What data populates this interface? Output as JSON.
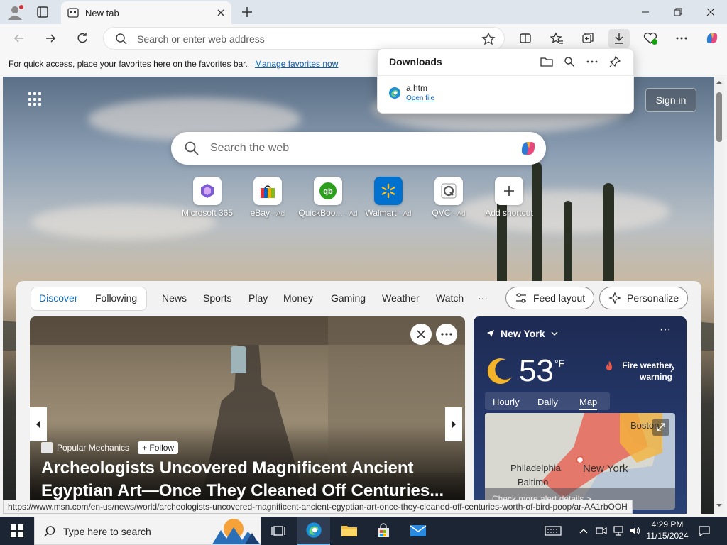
{
  "browser": {
    "tab_title": "New tab",
    "address_placeholder": "Search or enter web address",
    "favorites_message": "For quick access, place your favorites here on the favorites bar.",
    "favorites_link": "Manage favorites now"
  },
  "downloads": {
    "title": "Downloads",
    "file_name": "a.htm",
    "open_file": "Open file"
  },
  "newtab": {
    "sign_in": "Sign in",
    "search_placeholder": "Search the web",
    "shortcuts": [
      {
        "label": "Microsoft 365",
        "ad": ""
      },
      {
        "label": "eBay",
        "ad": "· Ad"
      },
      {
        "label": "QuickBoo...",
        "ad": "· Ad"
      },
      {
        "label": "Walmart",
        "ad": "· Ad"
      },
      {
        "label": "QVC",
        "ad": "· Ad"
      },
      {
        "label": "Add shortcut",
        "ad": ""
      }
    ]
  },
  "feed": {
    "tabs": [
      "Discover",
      "Following",
      "News",
      "Sports",
      "Play",
      "Money",
      "Gaming",
      "Weather",
      "Watch",
      "···"
    ],
    "feed_layout": "Feed layout",
    "personalize": "Personalize",
    "hero": {
      "source": "Popular Mechanics",
      "follow": "+ Follow",
      "headline": "Archeologists Uncovered Magnificent Ancient Egyptian Art—Once They Cleaned Off Centuries..."
    }
  },
  "weather": {
    "location": "New York",
    "temperature": "53",
    "unit": "°F",
    "warning": "Fire weather warning",
    "tabs": [
      "Hourly",
      "Daily",
      "Map"
    ],
    "active_tab": "Map",
    "map_labels": {
      "boston": "Boston",
      "philadelphia": "Philadelphia",
      "new_york": "New York",
      "baltimore": "Baltimo"
    },
    "map_details": "Check more alert details >"
  },
  "status_url": "https://www.msn.com/en-us/news/world/archeologists-uncovered-magnificent-ancient-egyptian-art-once-they-cleaned-off-centuries-worth-of-bird-poop/ar-AA1rbOOH",
  "taskbar": {
    "search_placeholder": "Type here to search",
    "time": "4:29 PM",
    "date": "11/15/2024"
  },
  "colors": {
    "accent": "#0f6cbd",
    "taskbar": "#1c2534",
    "weather_bg": "#263a6e"
  }
}
